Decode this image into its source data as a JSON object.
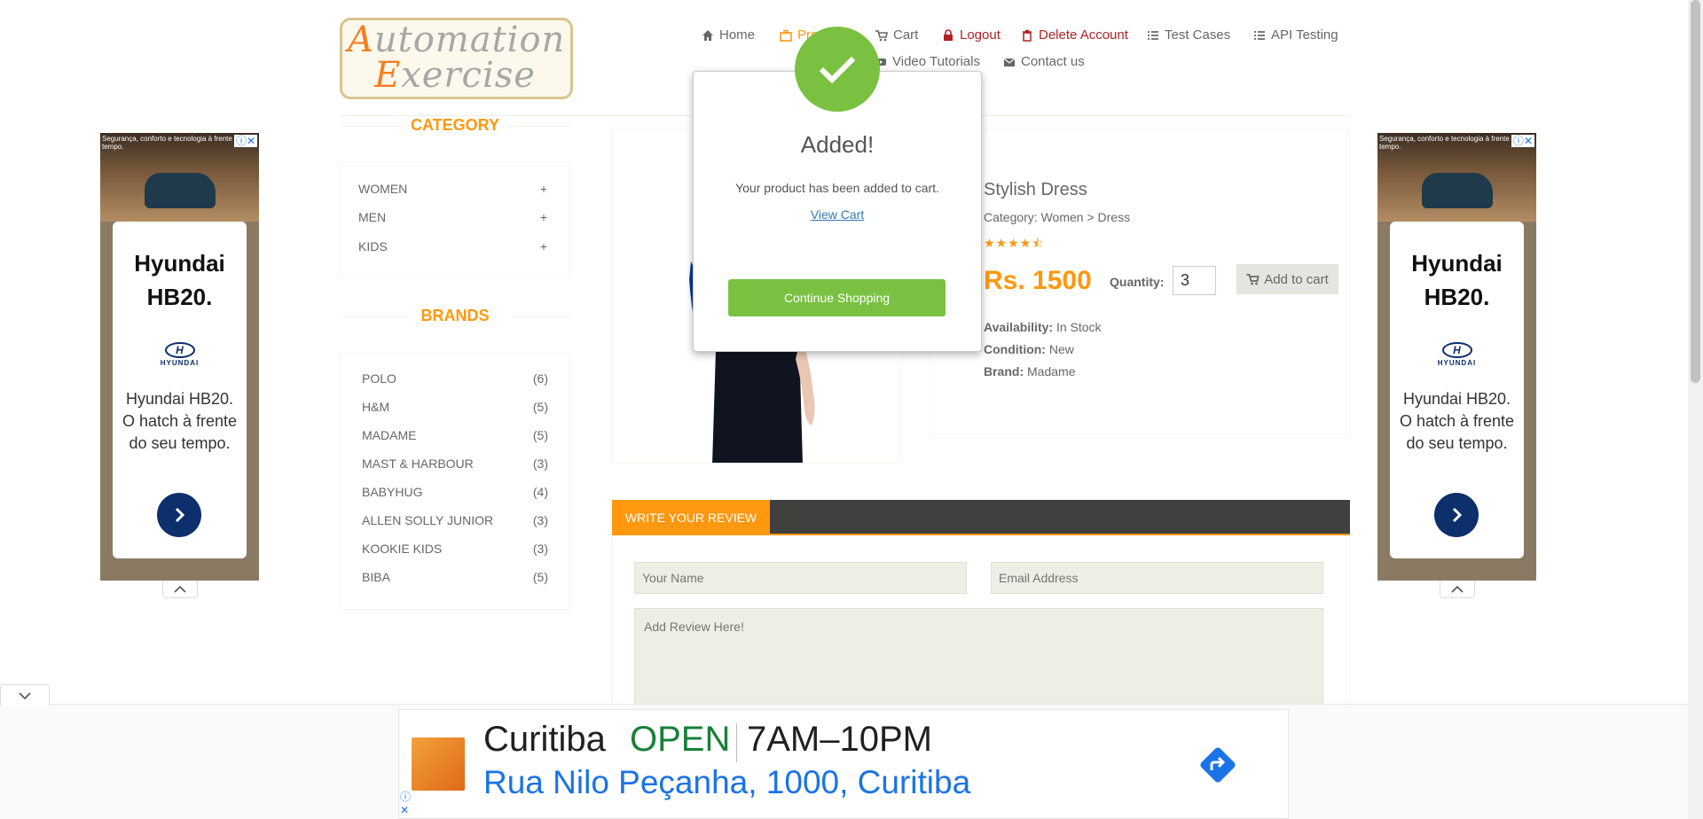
{
  "logo": {
    "line1_first": "A",
    "line1_rest": "utomation",
    "line2_first": "E",
    "line2_rest": "xercise"
  },
  "nav": {
    "home": "Home",
    "products": "Products",
    "cart": "Cart",
    "logout": "Logout",
    "delete_account": "Delete Account",
    "test_cases": "Test Cases",
    "api_testing": "API Testing",
    "video_tutorials": "Video Tutorials",
    "contact_us": "Contact us"
  },
  "sidebar": {
    "category_title": "CATEGORY",
    "categories": [
      {
        "label": "WOMEN",
        "icon": "+"
      },
      {
        "label": "MEN",
        "icon": "+"
      },
      {
        "label": "KIDS",
        "icon": "+"
      }
    ],
    "brands_title": "BRANDS",
    "brands": [
      {
        "label": "POLO",
        "count": "(6)"
      },
      {
        "label": "H&M",
        "count": "(5)"
      },
      {
        "label": "MADAME",
        "count": "(5)"
      },
      {
        "label": "MAST & HARBOUR",
        "count": "(3)"
      },
      {
        "label": "BABYHUG",
        "count": "(4)"
      },
      {
        "label": "ALLEN SOLLY JUNIOR",
        "count": "(3)"
      },
      {
        "label": "KOOKIE KIDS",
        "count": "(3)"
      },
      {
        "label": "BIBA",
        "count": "(5)"
      }
    ]
  },
  "product": {
    "name": "Stylish Dress",
    "category": "Category: Women > Dress",
    "rating_stars": 4.5,
    "price": "Rs. 1500",
    "quantity_label": "Quantity:",
    "quantity_value": "3",
    "add_to_cart": "Add to cart",
    "availability_label": "Availability:",
    "availability_value": "In Stock",
    "condition_label": "Condition:",
    "condition_value": "New",
    "brand_label": "Brand:",
    "brand_value": "Madame"
  },
  "review": {
    "tab_label": "WRITE YOUR REVIEW",
    "name_placeholder": "Your Name",
    "email_placeholder": "Email Address",
    "review_placeholder": "Add Review Here!"
  },
  "modal": {
    "title": "Added!",
    "message": "Your product has been added to cart.",
    "view_cart": "View Cart",
    "continue": "Continue Shopping"
  },
  "side_ad": {
    "photo_text": "Segurança, conforto e tecnologia à frente do seu tempo.",
    "title": "Hyundai HB20.",
    "brand": "HYUNDAI",
    "description": "Hyundai HB20. O hatch à frente do seu tempo."
  },
  "bottom_ad": {
    "city": "Curitiba",
    "status": "OPEN",
    "hours": "7AM–10PM",
    "address": "Rua Nilo Peçanha, 1000, Curitiba"
  },
  "colors": {
    "accent": "#fe980f",
    "success": "#7ac142",
    "danger": "#b22222",
    "dark_bar": "#40403e"
  }
}
